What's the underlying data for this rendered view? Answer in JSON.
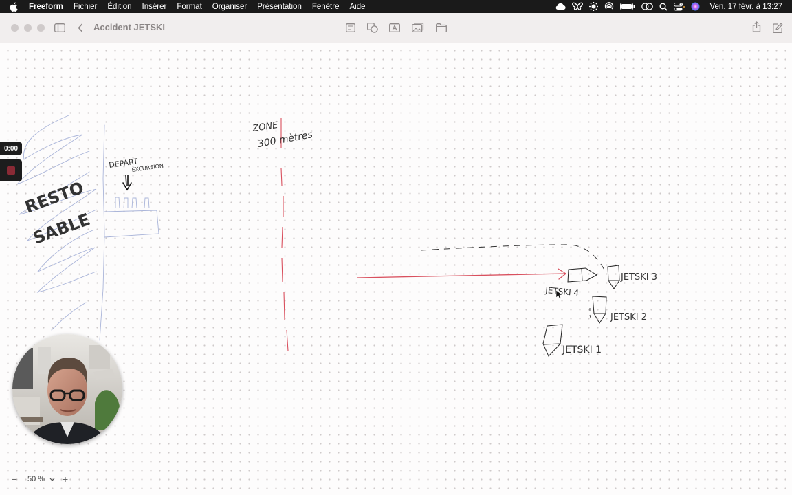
{
  "menubar": {
    "app_name": "Freeform",
    "items": [
      "Fichier",
      "Édition",
      "Insérer",
      "Format",
      "Organiser",
      "Présentation",
      "Fenêtre",
      "Aide"
    ],
    "clock": "Ven. 17 févr. à 13:27",
    "status_icons": [
      "cloud-icon",
      "butterfly-icon",
      "sun-icon",
      "airdrop-icon",
      "battery-icon",
      "link-icon",
      "search-icon",
      "control-center-icon",
      "siri-icon"
    ]
  },
  "window": {
    "title": "Accident JETSKI",
    "toolbar_icons": [
      "sidebar-icon",
      "back-chevron-icon",
      "note-icon",
      "shapes-icon",
      "text-box-icon",
      "media-icon",
      "folder-icon",
      "share-icon",
      "compose-icon"
    ]
  },
  "recording": {
    "timer": "0:00"
  },
  "board": {
    "resto_label_1": "RESTO",
    "resto_label_2": "SABLE",
    "depart_label_1": "DEPART",
    "depart_label_2": "EXCURSION",
    "zone_label_1": "ZONE",
    "zone_label_2": "300 mètres",
    "jetski_labels": [
      "JETSKI 4",
      "JETSKI 3",
      "JETSKI 2",
      "JETSKI 1"
    ],
    "colors": {
      "pen": "#222222",
      "red_line": "#d9505e",
      "beach": "#a9b4d9"
    }
  },
  "zoom": {
    "minus": "−",
    "value": "50 %",
    "plus": "+"
  }
}
